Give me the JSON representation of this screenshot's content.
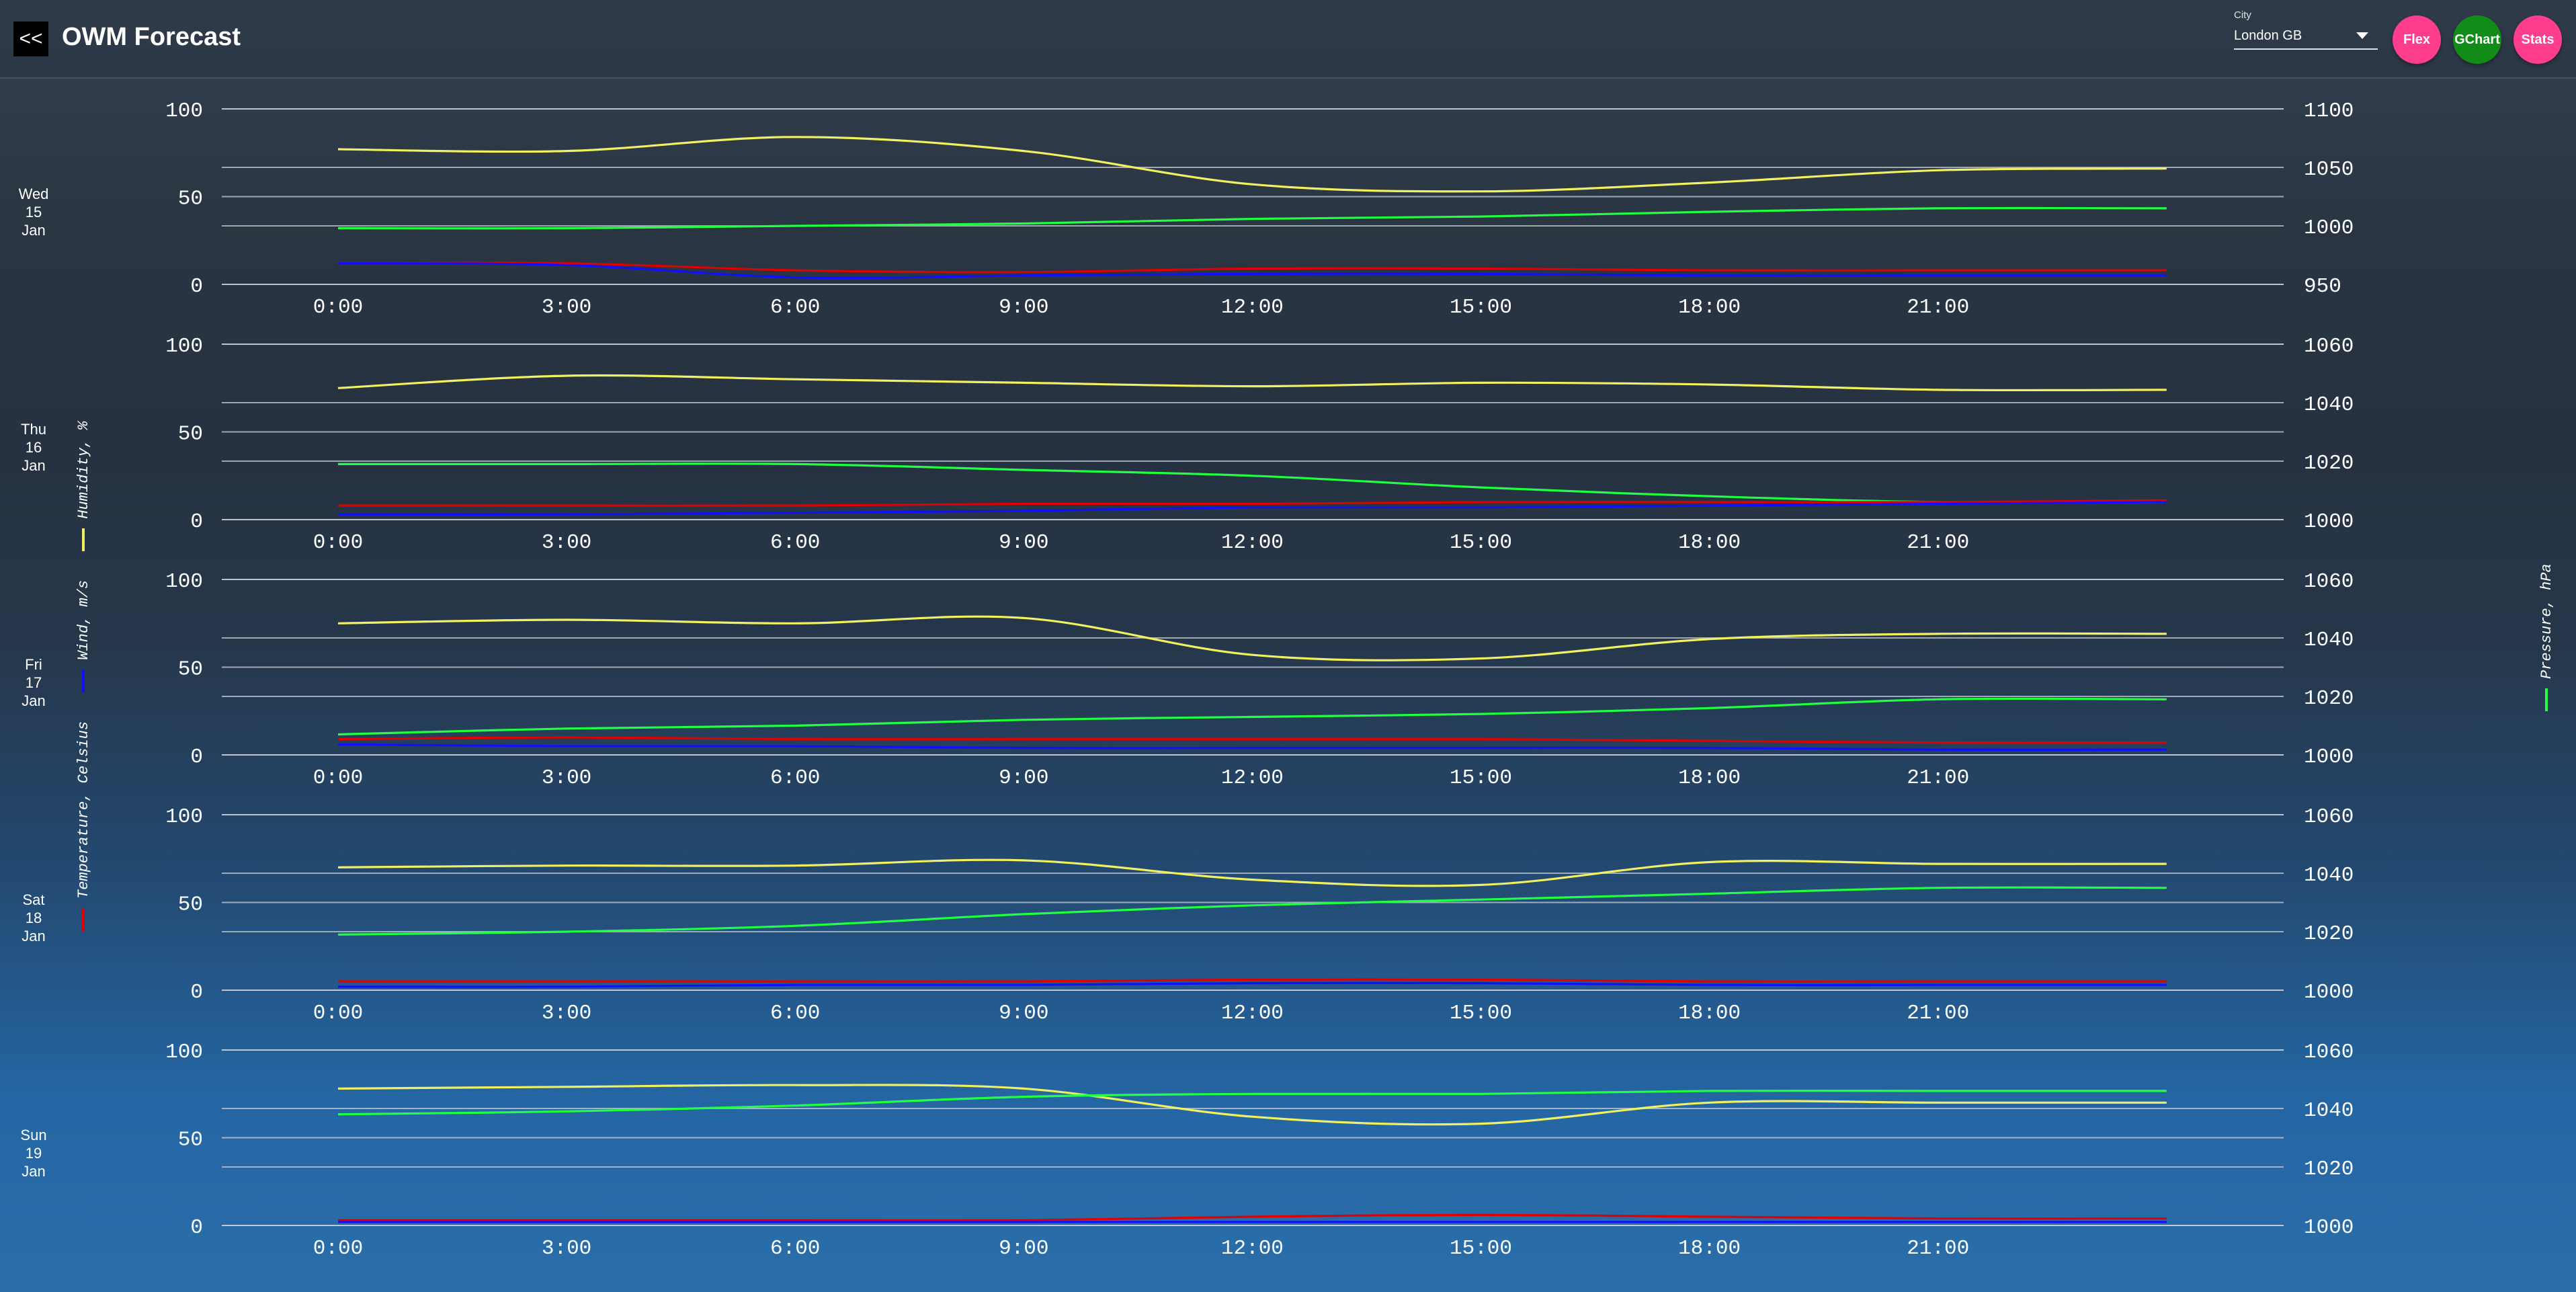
{
  "header": {
    "back_label": "<<",
    "title": "OWM Forecast",
    "city_label": "City",
    "city_value": "London GB",
    "buttons": {
      "flex": "Flex",
      "gchart": "GChart",
      "stats": "Stats"
    }
  },
  "legend": {
    "temperature": "Temperature, Celsius",
    "wind": "Wind, m/s",
    "humidity": "Humidity, %",
    "pressure": "Pressure, hPa"
  },
  "colors": {
    "temperature": "#e00000",
    "wind": "#1010ff",
    "humidity": "#f0f060",
    "pressure": "#20ff40",
    "grid": "#c8cdd6",
    "accent_pink": "#ff3d8d",
    "accent_green": "#128c18"
  },
  "chart_data": [
    {
      "type": "line",
      "day": [
        "Wed",
        "15",
        "Jan"
      ],
      "x_ticks": [
        "0:00",
        "3:00",
        "6:00",
        "9:00",
        "12:00",
        "15:00",
        "18:00",
        "21:00"
      ],
      "x": [
        0,
        3,
        6,
        9,
        12,
        15,
        18,
        21,
        24
      ],
      "ylim_left": [
        0,
        100
      ],
      "ylim_right": [
        950,
        1100
      ],
      "yticks_left": [
        "100",
        "50",
        "0"
      ],
      "yticks_right": [
        "1100",
        "1050",
        "1000",
        "950"
      ],
      "series": [
        {
          "name": "Humidity",
          "axis": "left",
          "color": "#f0f060",
          "values": [
            77,
            76,
            84,
            76,
            57,
            53,
            58,
            65,
            66
          ]
        },
        {
          "name": "Pressure",
          "axis": "right",
          "color": "#20ff40",
          "values": [
            998,
            998,
            1000,
            1002,
            1006,
            1008,
            1012,
            1015,
            1015
          ]
        },
        {
          "name": "Temperature",
          "axis": "left",
          "color": "#e00000",
          "values": [
            12,
            12,
            8,
            7,
            9,
            9,
            8,
            8,
            8
          ]
        },
        {
          "name": "Wind",
          "axis": "left",
          "color": "#1010ff",
          "values": [
            12,
            11,
            4,
            5,
            6,
            6,
            5,
            5,
            5
          ]
        }
      ]
    },
    {
      "type": "line",
      "day": [
        "Thu",
        "16",
        "Jan"
      ],
      "x_ticks": [
        "0:00",
        "3:00",
        "6:00",
        "9:00",
        "12:00",
        "15:00",
        "18:00",
        "21:00"
      ],
      "x": [
        0,
        3,
        6,
        9,
        12,
        15,
        18,
        21,
        24
      ],
      "ylim_left": [
        0,
        100
      ],
      "ylim_right": [
        1000,
        1060
      ],
      "yticks_left": [
        "100",
        "50",
        "0"
      ],
      "yticks_right": [
        "1060",
        "1040",
        "1020",
        "1000"
      ],
      "series": [
        {
          "name": "Humidity",
          "axis": "left",
          "color": "#f0f060",
          "values": [
            75,
            82,
            80,
            78,
            76,
            78,
            77,
            74,
            74
          ]
        },
        {
          "name": "Pressure",
          "axis": "right",
          "color": "#20ff40",
          "values": [
            1019,
            1019,
            1019,
            1017,
            1015,
            1011,
            1008,
            1006,
            1006
          ]
        },
        {
          "name": "Temperature",
          "axis": "left",
          "color": "#e00000",
          "values": [
            8,
            8,
            8,
            9,
            9,
            10,
            10,
            10,
            11
          ]
        },
        {
          "name": "Wind",
          "axis": "left",
          "color": "#1010ff",
          "values": [
            3,
            3,
            4,
            5,
            7,
            7,
            8,
            9,
            10
          ]
        }
      ]
    },
    {
      "type": "line",
      "day": [
        "Fri",
        "17",
        "Jan"
      ],
      "x_ticks": [
        "0:00",
        "3:00",
        "6:00",
        "9:00",
        "12:00",
        "15:00",
        "18:00",
        "21:00"
      ],
      "x": [
        0,
        3,
        6,
        9,
        12,
        15,
        18,
        21,
        24
      ],
      "ylim_left": [
        0,
        100
      ],
      "ylim_right": [
        1000,
        1060
      ],
      "yticks_left": [
        "100",
        "50",
        "0"
      ],
      "yticks_right": [
        "1060",
        "1040",
        "1020",
        "1000"
      ],
      "series": [
        {
          "name": "Humidity",
          "axis": "left",
          "color": "#f0f060",
          "values": [
            75,
            77,
            75,
            78,
            57,
            55,
            66,
            69,
            69
          ]
        },
        {
          "name": "Pressure",
          "axis": "right",
          "color": "#20ff40",
          "values": [
            1007,
            1009,
            1010,
            1012,
            1013,
            1014,
            1016,
            1019,
            1019
          ]
        },
        {
          "name": "Temperature",
          "axis": "left",
          "color": "#e00000",
          "values": [
            9,
            10,
            9,
            9,
            9,
            9,
            8,
            7,
            7
          ]
        },
        {
          "name": "Wind",
          "axis": "left",
          "color": "#1010ff",
          "values": [
            6,
            5,
            5,
            4,
            4,
            4,
            4,
            3,
            3
          ]
        }
      ]
    },
    {
      "type": "line",
      "day": [
        "Sat",
        "18",
        "Jan"
      ],
      "x_ticks": [
        "0:00",
        "3:00",
        "6:00",
        "9:00",
        "12:00",
        "15:00",
        "18:00",
        "21:00"
      ],
      "x": [
        0,
        3,
        6,
        9,
        12,
        15,
        18,
        21,
        24
      ],
      "ylim_left": [
        0,
        100
      ],
      "ylim_right": [
        1000,
        1060
      ],
      "yticks_left": [
        "100",
        "50",
        "0"
      ],
      "yticks_right": [
        "1060",
        "1040",
        "1020",
        "1000"
      ],
      "series": [
        {
          "name": "Humidity",
          "axis": "left",
          "color": "#f0f060",
          "values": [
            70,
            71,
            71,
            74,
            63,
            60,
            73,
            72,
            72
          ]
        },
        {
          "name": "Pressure",
          "axis": "right",
          "color": "#20ff40",
          "values": [
            1019,
            1020,
            1022,
            1026,
            1029,
            1031,
            1033,
            1035,
            1035
          ]
        },
        {
          "name": "Temperature",
          "axis": "left",
          "color": "#e00000",
          "values": [
            5,
            5,
            5,
            5,
            6,
            6,
            5,
            5,
            5
          ]
        },
        {
          "name": "Wind",
          "axis": "left",
          "color": "#1010ff",
          "values": [
            2,
            2,
            3,
            3,
            4,
            4,
            3,
            3,
            3
          ]
        }
      ]
    },
    {
      "type": "line",
      "day": [
        "Sun",
        "19",
        "Jan"
      ],
      "x_ticks": [
        "0:00",
        "3:00",
        "6:00",
        "9:00",
        "12:00",
        "15:00",
        "18:00",
        "21:00"
      ],
      "x": [
        0,
        3,
        6,
        9,
        12,
        15,
        18,
        21,
        24
      ],
      "ylim_left": [
        0,
        100
      ],
      "ylim_right": [
        1000,
        1060
      ],
      "yticks_left": [
        "100",
        "50",
        "0"
      ],
      "yticks_right": [
        "1060",
        "1040",
        "1020",
        "1000"
      ],
      "series": [
        {
          "name": "Humidity",
          "axis": "left",
          "color": "#f0f060",
          "values": [
            78,
            79,
            80,
            78,
            62,
            58,
            70,
            70,
            70
          ]
        },
        {
          "name": "Pressure",
          "axis": "right",
          "color": "#20ff40",
          "values": [
            1038,
            1039,
            1041,
            1044,
            1045,
            1045,
            1046,
            1046,
            1046
          ]
        },
        {
          "name": "Temperature",
          "axis": "left",
          "color": "#e00000",
          "values": [
            3,
            3,
            3,
            3,
            5,
            6,
            5,
            4,
            4
          ]
        },
        {
          "name": "Wind",
          "axis": "left",
          "color": "#1010ff",
          "values": [
            2,
            2,
            2,
            2,
            2,
            2,
            2,
            2,
            2
          ]
        }
      ]
    }
  ]
}
